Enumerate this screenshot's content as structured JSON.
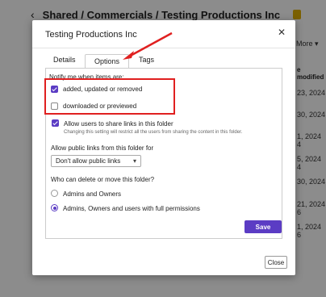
{
  "background": {
    "breadcrumb": "Shared / Commercials / Testing Productions Inc",
    "more_label": "More",
    "column_header": "e modified",
    "dates": [
      "23, 2024",
      "30, 2024",
      "1, 2024 4",
      "5, 2024 4",
      "30, 2024",
      "21, 2024 6",
      "1, 2024 6"
    ]
  },
  "modal": {
    "title": "Testing Productions Inc",
    "close_icon": "close-icon",
    "tabs": [
      {
        "label": "Details",
        "active": false
      },
      {
        "label": "Options",
        "active": true
      },
      {
        "label": "Tags",
        "active": false
      }
    ],
    "notify_heading": "Notify me when items are:",
    "notify_options": [
      {
        "label": "added, updated or removed",
        "checked": true
      },
      {
        "label": "downloaded or previewed",
        "checked": false
      }
    ],
    "share_links": {
      "label": "Allow users to share links in this folder",
      "hint": "Changing this setting will restrict all the users from sharing the content in this folder.",
      "checked": true
    },
    "public_links": {
      "label": "Allow public links from this folder for",
      "selected": "Don't allow public links"
    },
    "delete_move": {
      "label": "Who can delete or move this folder?",
      "options": [
        {
          "label": "Admins and Owners",
          "selected": false
        },
        {
          "label": "Admins, Owners and users with full permissions",
          "selected": true
        }
      ]
    },
    "save_label": "Save",
    "close_label": "Close"
  },
  "colors": {
    "accent": "#5b3cc4",
    "highlight": "#e02020"
  }
}
